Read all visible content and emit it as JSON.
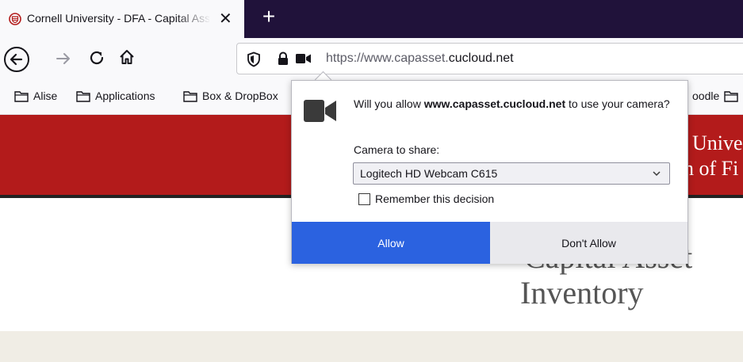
{
  "browser": {
    "tab": {
      "title": "Cornell University - DFA - Capital Asset Inventory",
      "favicon": "cornell-shield-icon",
      "close_label": "✕"
    },
    "new_tab_label": "+",
    "url": {
      "prefix": "https://www.capasset.",
      "domain": "cucloud.net"
    },
    "bookmarks": [
      "Alise",
      "Applications",
      "Box & DropBox",
      "oodle"
    ]
  },
  "page": {
    "header_line_1": "Unive",
    "header_line_2": "n of Fi",
    "title_line_1": "Capital Asset",
    "title_line_2": "Inventory"
  },
  "popup": {
    "message_prefix": "Will you allow ",
    "message_domain": "www.capasset.cucloud.net",
    "message_suffix": " to use your camera?",
    "camera_label": "Camera to share:",
    "camera_selected": "Logitech HD Webcam C615",
    "remember_label": "Remember this decision",
    "allow_label": "Allow",
    "deny_label": "Don't Allow"
  },
  "colors": {
    "accent": "#2b62e0",
    "cornell_red": "#b31b1b",
    "tabstrip": "#20123a"
  }
}
